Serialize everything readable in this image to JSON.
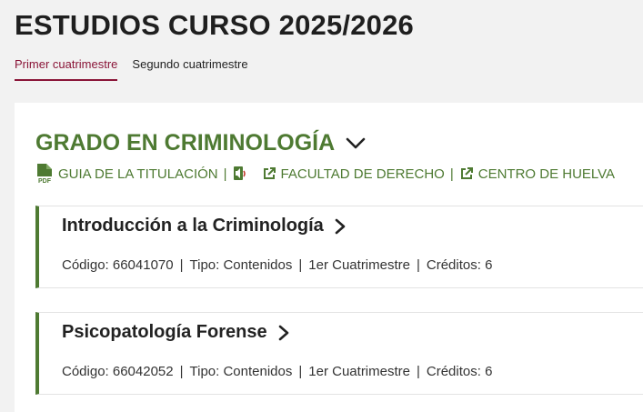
{
  "page": {
    "title": "ESTUDIOS CURSO 2025/2026"
  },
  "tabs": [
    {
      "label": "Primer cuatrimestre",
      "active": true
    },
    {
      "label": "Segundo cuatrimestre",
      "active": false
    }
  ],
  "degree": {
    "title": "GRADO EN CRIMINOLOGÍA",
    "links": {
      "guide": "GUIA DE LA TITULACIÓN",
      "faculty": "FACULTAD DE DERECHO",
      "center": "CENTRO DE HUELVA",
      "separator": "|"
    }
  },
  "subjects": [
    {
      "name": "Introducción a la Criminología",
      "code": "Código: 66041070",
      "type": "Tipo: Contenidos",
      "term": "1er Cuatrimestre",
      "credits": "Créditos: 6"
    },
    {
      "name": "Psicopatología Forense",
      "code": "Código: 66042052",
      "type": "Tipo: Contenidos",
      "term": "1er Cuatrimestre",
      "credits": "Créditos: 6"
    }
  ],
  "colors": {
    "accent": "#4e7a32",
    "tab_active": "#8a1538",
    "background": "#f2f2f2"
  },
  "icons": [
    "pdf-icon",
    "audio-icon",
    "external-link-icon",
    "chevron-down-icon",
    "chevron-right-icon"
  ]
}
